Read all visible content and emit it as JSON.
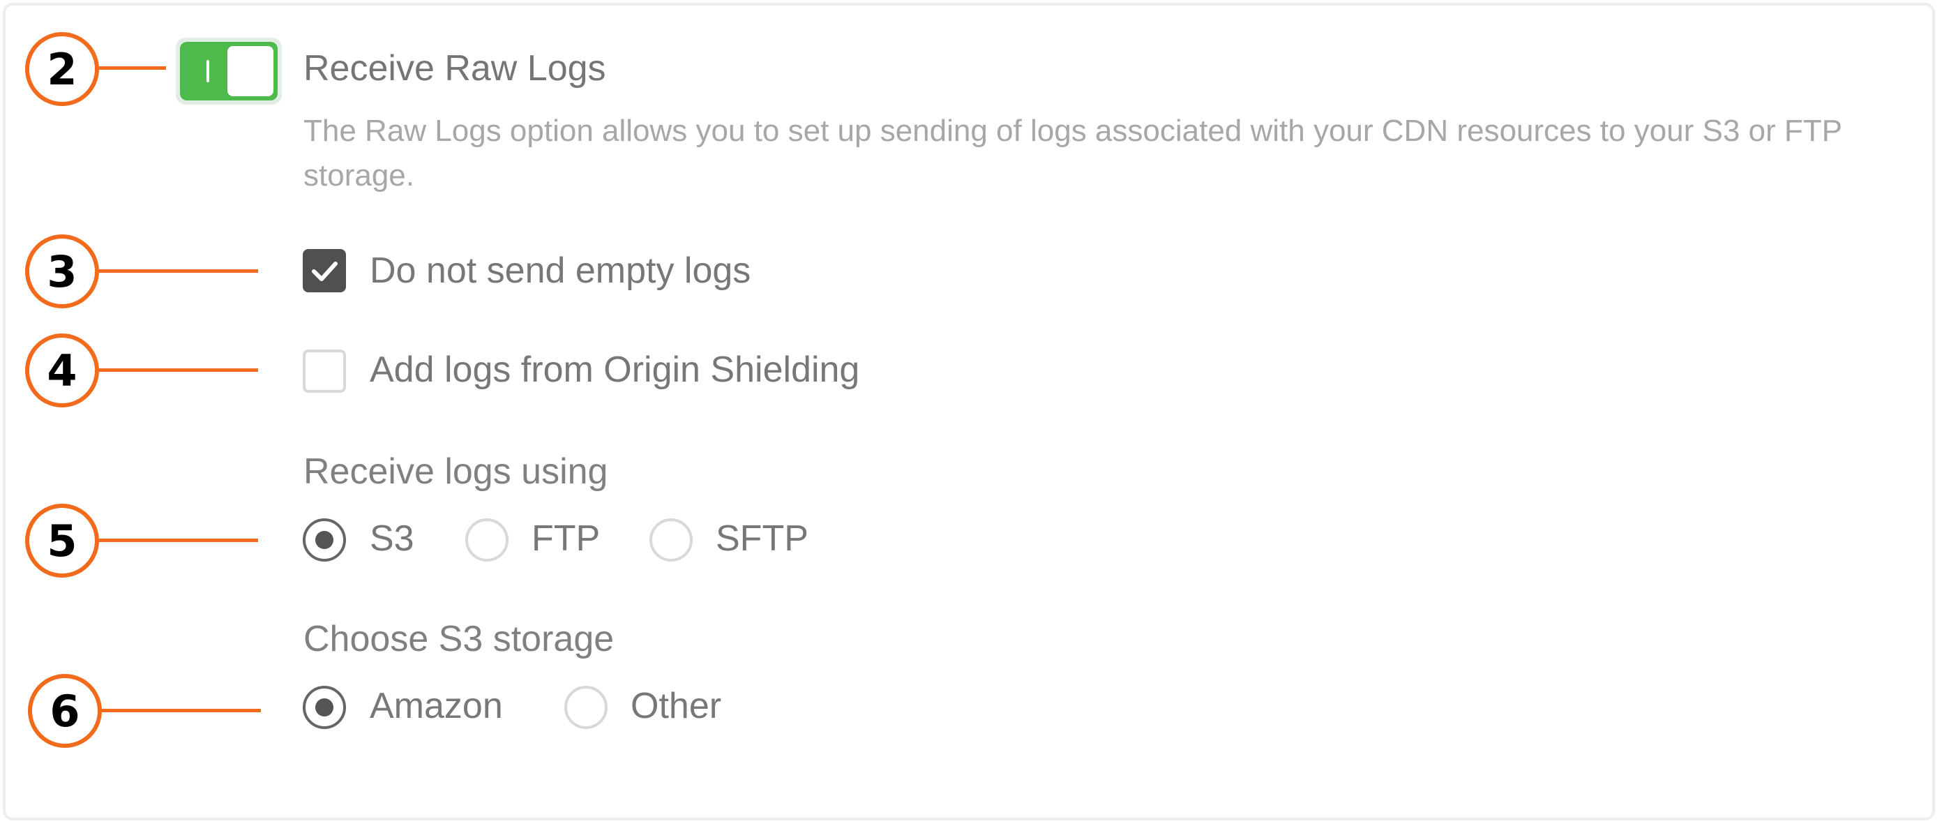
{
  "callouts": [
    "2",
    "3",
    "4",
    "5",
    "6"
  ],
  "raw_logs": {
    "toggle_on": true,
    "toggle_color": "#4eba4b",
    "title": "Receive Raw Logs",
    "description": "The Raw Logs option allows you to set up sending of logs associated with your CDN resources to your S3 or FTP storage."
  },
  "options": {
    "empty_logs": {
      "label": "Do not send empty logs",
      "checked": true
    },
    "origin_shielding": {
      "label": "Add logs from Origin Shielding",
      "checked": false
    }
  },
  "protocol": {
    "label": "Receive logs using",
    "choices": [
      "S3",
      "FTP",
      "SFTP"
    ],
    "selected": "S3"
  },
  "storage": {
    "label": "Choose S3 storage",
    "choices": [
      "Amazon",
      "Other"
    ],
    "selected": "Amazon"
  },
  "colors": {
    "callout": "#f26b1d",
    "checkbox_checked": "#505050"
  }
}
